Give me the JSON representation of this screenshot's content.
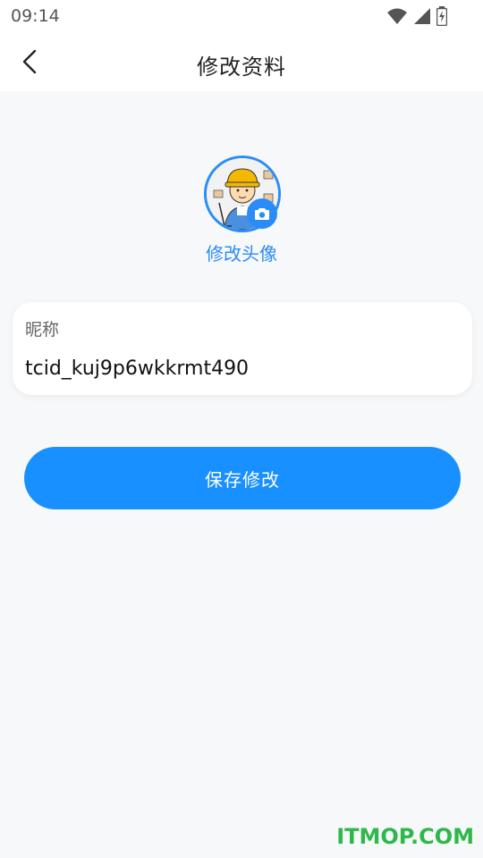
{
  "status_bar": {
    "time": "09:14",
    "icons": [
      "wifi-icon",
      "signal-icon",
      "battery-charging-icon"
    ]
  },
  "header": {
    "title": "修改资料",
    "back_icon": "chevron-left-icon"
  },
  "avatar": {
    "label": "修改头像",
    "badge_icon": "camera-icon",
    "accent": "#2b8cf7"
  },
  "nickname": {
    "label": "昵称",
    "value": "tcid_kuj9p6wkkrmt490"
  },
  "save_button": {
    "label": "保存修改",
    "color": "#1890ff"
  },
  "watermark": "ITMOP.COM"
}
